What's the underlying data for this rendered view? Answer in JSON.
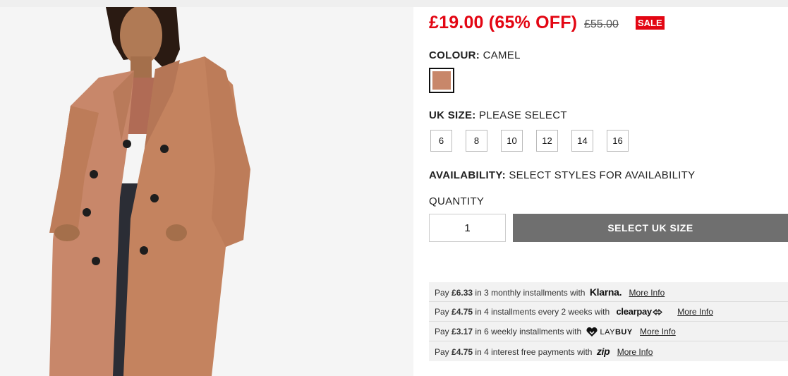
{
  "product": {
    "image_alt": "camel-coat-model-photo",
    "price_now": "£19.00 (65% OFF)",
    "price_was": "£55.00",
    "sale_badge": "SALE"
  },
  "colour": {
    "label": "COLOUR:",
    "value": "CAMEL",
    "swatch_color": "#c8876a"
  },
  "size": {
    "label": "UK SIZE:",
    "value": "PLEASE SELECT",
    "options": [
      "6",
      "8",
      "10",
      "12",
      "14",
      "16"
    ]
  },
  "availability": {
    "label": "AVAILABILITY:",
    "value": "SELECT STYLES FOR AVAILABILITY"
  },
  "quantity": {
    "label": "QUANTITY",
    "value": "1"
  },
  "cta": {
    "label": "SELECT UK SIZE"
  },
  "payments": [
    {
      "prefix": "Pay",
      "amount": "£6.33",
      "text": "in 3 monthly installments with",
      "brand": "Klarna.",
      "link": "More Info"
    },
    {
      "prefix": "Pay",
      "amount": "£4.75",
      "text": "in 4 installments every 2 weeks with",
      "brand": "clearpay",
      "link": "More Info"
    },
    {
      "prefix": "Pay",
      "amount": "£3.17",
      "text": "in 6 weekly installments with",
      "brand_lay": "LAY",
      "brand_buy": "BUY",
      "link": "More Info"
    },
    {
      "prefix": "Pay",
      "amount": "£4.75",
      "text": "in 4 interest free payments with",
      "brand": "zip",
      "link": "More Info"
    }
  ],
  "colors": {
    "sale_red": "#e30613",
    "cta_grey": "#6f6f6f",
    "coat_camel": "#c8876a"
  }
}
